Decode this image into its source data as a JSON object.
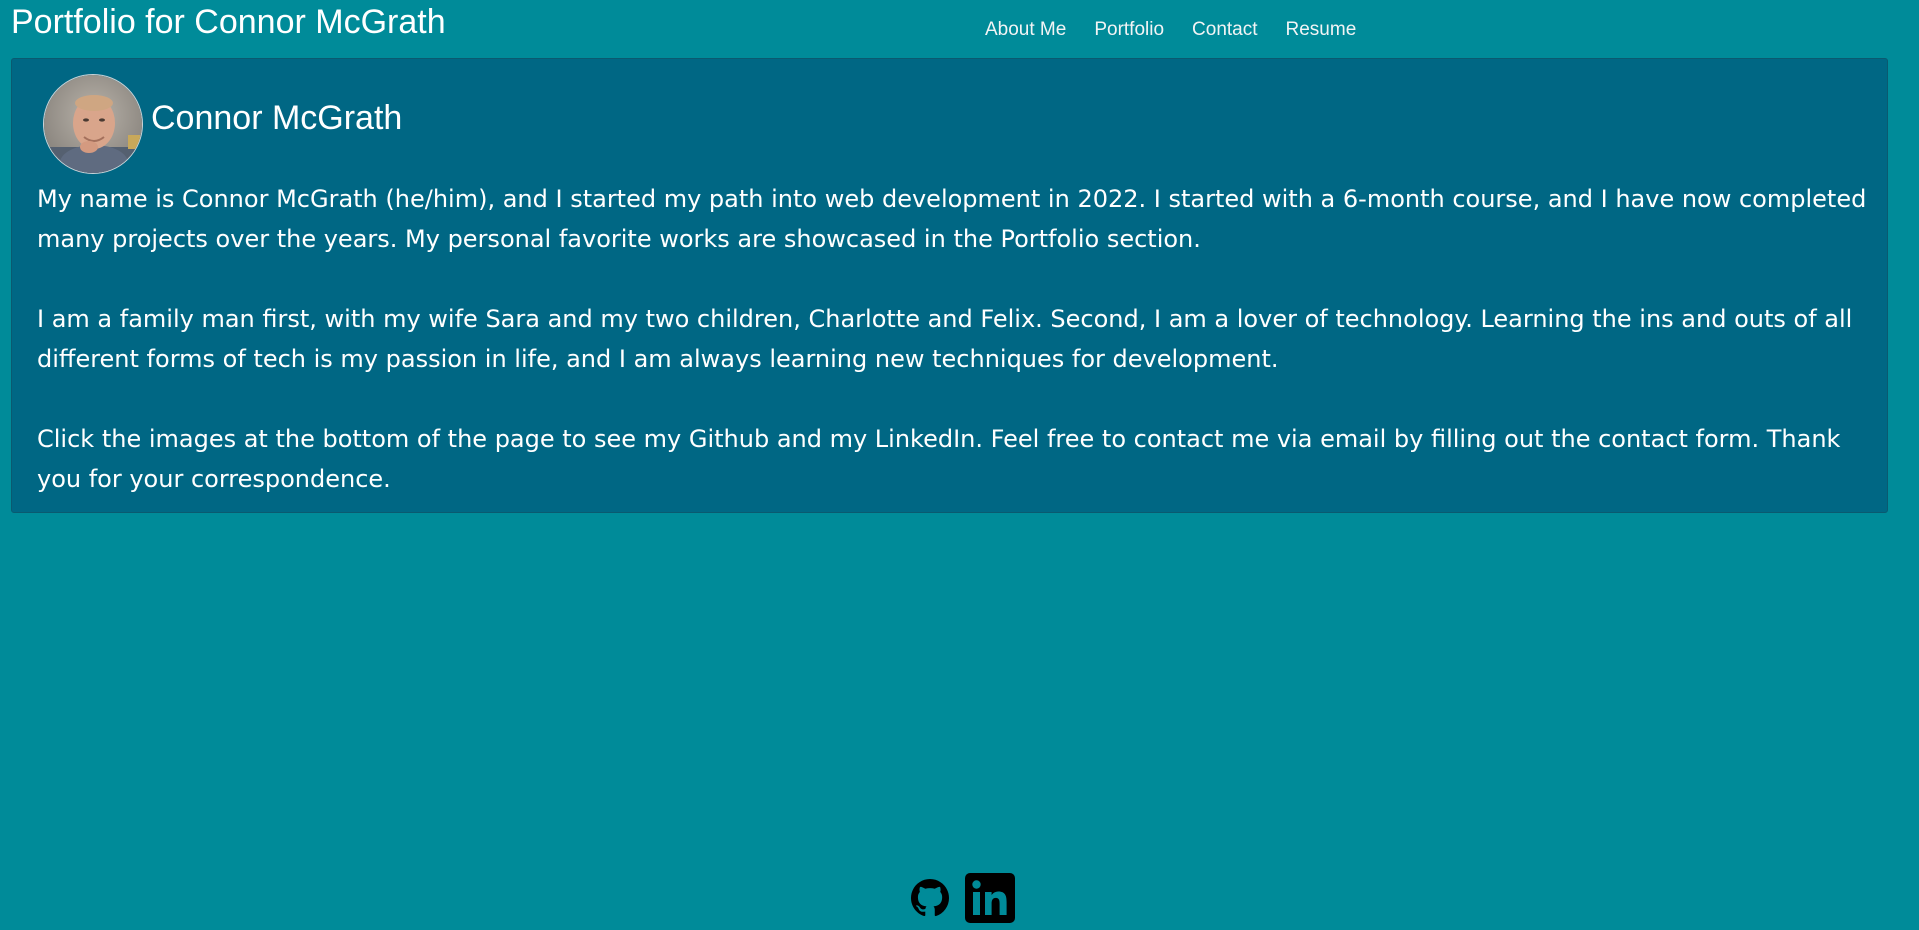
{
  "header": {
    "title": "Portfolio for Connor McGrath",
    "nav": [
      "About Me",
      "Portfolio",
      "Contact",
      "Resume"
    ]
  },
  "about": {
    "name": "Connor McGrath",
    "avatar_icon": "profile-photo",
    "paragraphs": [
      "My name is Connor McGrath (he/him), and I started my path into web development in 2022. I started with a 6-month course, and I have now completed many projects over the years. My personal favorite works are showcased in the Portfolio section.",
      "I am a family man first, with my wife Sara and my two children, Charlotte and Felix. Second, I am a lover of technology. Learning the ins and outs of all different forms of tech is my passion in life, and I am always learning new techniques for development.",
      "Click the images at the bottom of the page to see my Github and my LinkedIn. Feel free to contact me via email by filling out the contact form. Thank you for your correspondence."
    ]
  },
  "footer": {
    "links": [
      {
        "icon": "github-icon"
      },
      {
        "icon": "linkedin-icon"
      }
    ]
  },
  "colors": {
    "background": "#008b99",
    "card": "#006784",
    "text": "#ffffff"
  }
}
